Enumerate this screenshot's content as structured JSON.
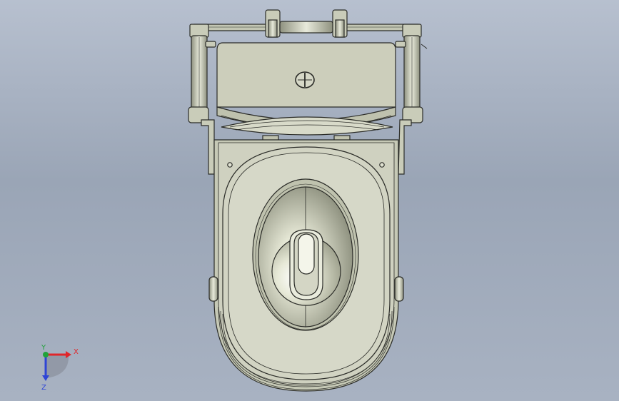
{
  "viewport": {
    "background_top": "#b7c0cf",
    "background_bottom": "#a8b2c2",
    "model_fill": "#c9ccb9",
    "model_edge": "#2b2c28",
    "shadow_fill": "#8f9382"
  },
  "triad": {
    "x_label": "X",
    "y_label": "Y",
    "z_label": "Z",
    "x_color": "#e0262a",
    "y_color": "#21a33a",
    "z_color": "#2e45d6"
  },
  "model": {
    "center_mark_icon": "center-mark-icon"
  }
}
